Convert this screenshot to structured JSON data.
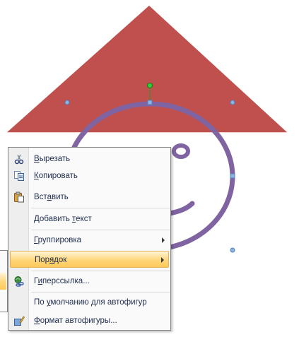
{
  "context_menu": {
    "items": [
      {
        "key": "cut",
        "label_pre": "",
        "mnemonic": "В",
        "label_post": "ырезать",
        "icon": "scissors-icon"
      },
      {
        "key": "copy",
        "label_pre": "",
        "mnemonic": "К",
        "label_post": "опировать",
        "icon": "copy-icon"
      },
      {
        "key": "paste",
        "label_pre": "Вст",
        "mnemonic": "а",
        "label_post": "вить",
        "icon": "paste-icon"
      },
      {
        "key": "add-text",
        "label_pre": "Добавить ",
        "mnemonic": "т",
        "label_post": "екст",
        "icon": ""
      },
      {
        "key": "grouping",
        "label_pre": "",
        "mnemonic": "Г",
        "label_post": "руппировка",
        "icon": "",
        "submenu": true
      },
      {
        "key": "order",
        "label_pre": "Пор",
        "mnemonic": "я",
        "label_post": "док",
        "icon": "",
        "submenu": true,
        "highlighted": true
      },
      {
        "key": "hyperlink",
        "label_pre": "Г",
        "mnemonic": "и",
        "label_post": "перссылка...",
        "icon": "hyperlink-icon"
      },
      {
        "key": "default-autoshape",
        "label_pre": "По ",
        "mnemonic": "у",
        "label_post": "молчанию для автофигур",
        "icon": ""
      },
      {
        "key": "format-autoshape",
        "label_pre": "",
        "mnemonic": "Ф",
        "label_post": "ормат автофигуры...",
        "icon": "format-autoshape-icon"
      }
    ]
  },
  "colors": {
    "triangle_fill": "#c0504d",
    "smiley_stroke": "#8064a2",
    "handle_fill": "#4f81bd",
    "rotation_handle": "#1aa01a",
    "menu_highlight": "#ffd67a"
  }
}
